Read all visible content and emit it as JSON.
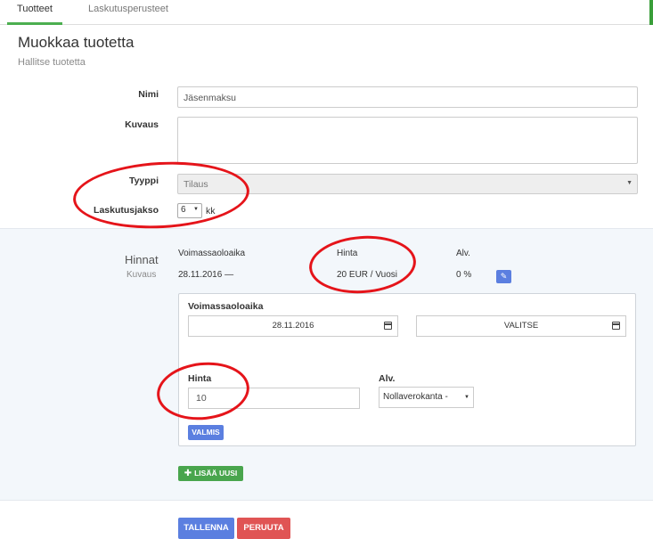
{
  "tabs": [
    {
      "label": "Tuotteet",
      "active": true
    },
    {
      "label": "Laskutusperusteet",
      "active": false
    }
  ],
  "header": {
    "title": "Muokkaa tuotetta",
    "subtitle": "Hallitse tuotetta"
  },
  "form": {
    "nimi_label": "Nimi",
    "nimi_value": "Jäsenmaksu",
    "kuvaus_label": "Kuvaus",
    "kuvaus_value": "",
    "tyyppi_label": "Tyyppi",
    "tyyppi_value": "Tilaus",
    "laskutusjakso_label": "Laskutusjakso",
    "laskutusjakso_value": "6",
    "laskutusjakso_unit": "kk"
  },
  "prices": {
    "title": "Hinnat",
    "subtitle": "Kuvaus",
    "columns": {
      "validity": "Voimassaoloaika",
      "price": "Hinta",
      "vat": "Alv."
    },
    "rows": [
      {
        "validity": "28.11.2016 —",
        "price": "20 EUR / Vuosi",
        "vat": "0 %"
      }
    ],
    "editor": {
      "validity_label": "Voimassaoloaika",
      "start_date": "28.11.2016",
      "end_date": "VALITSE",
      "price_label": "Hinta",
      "price_value": "10",
      "vat_label": "Alv.",
      "vat_value": "Nollaverokanta -",
      "done_button": "VALMIS"
    },
    "add_button": "LISÄÄ UUSI"
  },
  "actions": {
    "save_button": "TALLENNA",
    "cancel_button": "PERUUTA"
  },
  "colors": {
    "primary": "#5b7fe0",
    "success": "#49a54d",
    "danger": "#e05454",
    "annotation": "#e5141a"
  }
}
